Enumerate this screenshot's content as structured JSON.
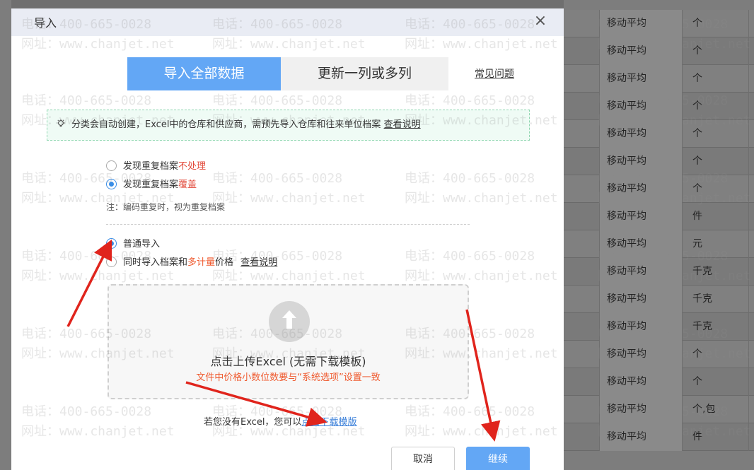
{
  "background_table": {
    "rows": [
      {
        "method": "移动平均",
        "unit": "个"
      },
      {
        "method": "移动平均",
        "unit": "个"
      },
      {
        "method": "移动平均",
        "unit": "个"
      },
      {
        "method": "移动平均",
        "unit": "个"
      },
      {
        "method": "移动平均",
        "unit": "个"
      },
      {
        "method": "移动平均",
        "unit": "个"
      },
      {
        "method": "移动平均",
        "unit": "个"
      },
      {
        "method": "移动平均",
        "unit": "件"
      },
      {
        "method": "移动平均",
        "unit": "元"
      },
      {
        "method": "移动平均",
        "unit": "千克"
      },
      {
        "method": "移动平均",
        "unit": "千克"
      },
      {
        "method": "移动平均",
        "unit": "千克"
      },
      {
        "method": "移动平均",
        "unit": "个"
      },
      {
        "method": "移动平均",
        "unit": "个"
      },
      {
        "method": "移动平均",
        "unit": "个,包"
      },
      {
        "method": "移动平均",
        "unit": "件"
      }
    ]
  },
  "modal": {
    "title": "导入",
    "close_icon": "×",
    "tabs": [
      {
        "label": "导入全部数据"
      },
      {
        "label": "更新一列或多列"
      }
    ],
    "faq_link": "常见问题",
    "notice": {
      "icon": "lightbulb-icon",
      "text": "分类会自动创建，Excel中的仓库和供应商，需预先导入仓库和往来单位档案",
      "link": "查看说明"
    },
    "duplicate_options": [
      {
        "prefix": "发现重复档案",
        "highlight": "不处理",
        "selected": false
      },
      {
        "prefix": "发现重复档案",
        "highlight": "覆盖",
        "selected": true
      }
    ],
    "duplicate_note": "注：编码重复时，视为重复档案",
    "import_modes": [
      {
        "label": "普通导入",
        "selected": true
      },
      {
        "prefix": "同时导入档案和",
        "highlight": "多计量",
        "suffix": "价格",
        "link": "查看说明",
        "selected": false
      }
    ],
    "upload": {
      "icon": "upload-icon",
      "text": "点击上传Excel (无需下载模板)",
      "subtext": "文件中价格小数位数要与“系统选项”设置一致"
    },
    "download": {
      "prefix": "若您没有Excel，您可以",
      "link": "点击下载模版"
    },
    "buttons": {
      "cancel": "取消",
      "next": "继续"
    }
  },
  "watermark": {
    "phone": "电话：400-665-0028",
    "site": "网址：www.chanjet.net"
  },
  "colors": {
    "primary": "#63a7f5",
    "highlight_red": "#e24a3b",
    "arrow_red": "#e0241c"
  }
}
